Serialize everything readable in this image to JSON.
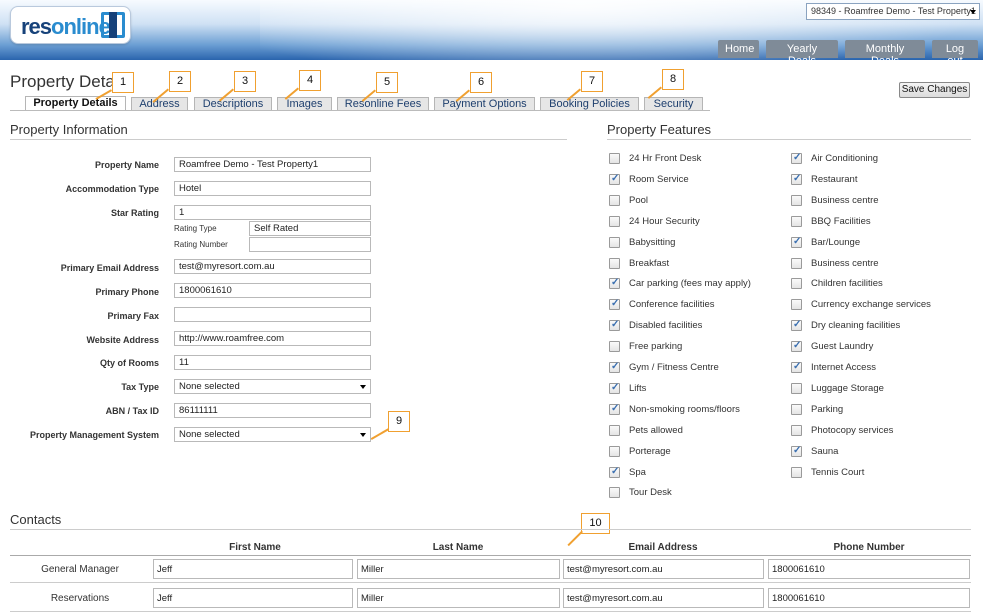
{
  "header": {
    "logo_text_a": "res",
    "logo_text_b": "online",
    "property_selector": "98349 - Roamfree Demo - Test Property1",
    "nav": [
      "Home",
      "Yearly Deals",
      "Monthly Deals",
      "Log out"
    ]
  },
  "page_title": "Property Deta",
  "save_label": "Save Changes",
  "tabs": [
    "Property Details",
    "Address",
    "Descriptions",
    "Images",
    "Resonline Fees",
    "Payment Options",
    "Booking Policies",
    "Security"
  ],
  "callouts": [
    "1",
    "2",
    "3",
    "4",
    "5",
    "6",
    "7",
    "8",
    "9",
    "10"
  ],
  "property_info": {
    "title": "Property Information",
    "name_label": "Property Name",
    "name_value": "Roamfree Demo - Test Property1",
    "acc_label": "Accommodation Type",
    "acc_value": "Hotel",
    "star_label": "Star Rating",
    "star_value": "1",
    "rating_type_label": "Rating Type",
    "rating_type_value": "Self Rated",
    "rating_number_label": "Rating Number",
    "rating_number_value": "",
    "email_label": "Primary Email Address",
    "email_value": "test@myresort.com.au",
    "phone_label": "Primary Phone",
    "phone_value": "1800061610",
    "fax_label": "Primary Fax",
    "fax_value": "",
    "website_label": "Website Address",
    "website_value": "http://www.roamfree.com",
    "rooms_label": "Qty of Rooms",
    "rooms_value": "11",
    "tax_label": "Tax Type",
    "tax_value": "None selected",
    "abn_label": "ABN / Tax ID",
    "abn_value": "86111111",
    "pms_label": "Property Management System",
    "pms_value": "None selected"
  },
  "features": {
    "title": "Property Features",
    "left": [
      {
        "label": "24 Hr Front Desk",
        "checked": false
      },
      {
        "label": "Room Service",
        "checked": true
      },
      {
        "label": "Pool",
        "checked": false
      },
      {
        "label": "24 Hour Security",
        "checked": false
      },
      {
        "label": "Babysitting",
        "checked": false
      },
      {
        "label": "Breakfast",
        "checked": false
      },
      {
        "label": "Car parking (fees may apply)",
        "checked": true
      },
      {
        "label": "Conference facilities",
        "checked": true
      },
      {
        "label": "Disabled facilities",
        "checked": true
      },
      {
        "label": "Free parking",
        "checked": false
      },
      {
        "label": "Gym / Fitness Centre",
        "checked": true
      },
      {
        "label": "Lifts",
        "checked": true
      },
      {
        "label": "Non-smoking rooms/floors",
        "checked": true
      },
      {
        "label": "Pets allowed",
        "checked": false
      },
      {
        "label": "Porterage",
        "checked": false
      },
      {
        "label": "Spa",
        "checked": true
      },
      {
        "label": "Tour Desk",
        "checked": false
      }
    ],
    "right": [
      {
        "label": "Air Conditioning",
        "checked": true
      },
      {
        "label": "Restaurant",
        "checked": true
      },
      {
        "label": "Business centre",
        "checked": false
      },
      {
        "label": "BBQ Facilities",
        "checked": false
      },
      {
        "label": "Bar/Lounge",
        "checked": true
      },
      {
        "label": "Business centre",
        "checked": false
      },
      {
        "label": "Children facilities",
        "checked": false
      },
      {
        "label": "Currency exchange services",
        "checked": false
      },
      {
        "label": "Dry cleaning facilities",
        "checked": true
      },
      {
        "label": "Guest Laundry",
        "checked": true
      },
      {
        "label": "Internet Access",
        "checked": true
      },
      {
        "label": "Luggage Storage",
        "checked": false
      },
      {
        "label": "Parking",
        "checked": false
      },
      {
        "label": "Photocopy services",
        "checked": false
      },
      {
        "label": "Sauna",
        "checked": true
      },
      {
        "label": "Tennis Court",
        "checked": false
      }
    ]
  },
  "contacts": {
    "title": "Contacts",
    "headers": [
      "First Name",
      "Last Name",
      "Email Address",
      "Phone Number"
    ],
    "rows": [
      {
        "role": "General Manager",
        "first": "Jeff",
        "last": "Miller",
        "email": "test@myresort.com.au",
        "phone": "1800061610"
      },
      {
        "role": "Reservations",
        "first": "Jeff",
        "last": "Miller",
        "email": "test@myresort.com.au",
        "phone": "1800061610"
      }
    ]
  },
  "colors": {
    "callout_border": "#f0a030",
    "header_blue": "#2a64ad",
    "nav_gray": "#7f8b98"
  }
}
